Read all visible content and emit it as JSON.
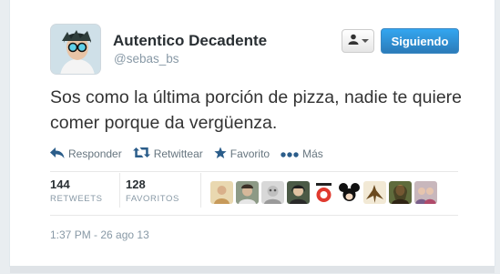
{
  "user": {
    "name": "Autentico Decadente",
    "screen_name": "@sebas_bs",
    "avatar_icon": "user-avatar"
  },
  "follow_button": {
    "label": "Siguiendo",
    "color": "#2b7bb9"
  },
  "user_dropdown_icon": "user-dropdown-icon",
  "tweet": {
    "text": "Sos como la última porción de pizza, nadie te quiere comer porque da vergüenza."
  },
  "actions": [
    {
      "label": "Responder",
      "icon": "reply-icon"
    },
    {
      "label": "Retwittear",
      "icon": "retweet-icon"
    },
    {
      "label": "Favorito",
      "icon": "star-icon"
    },
    {
      "label": "Más",
      "icon": "more-icon"
    }
  ],
  "stats": {
    "retweets": {
      "count": "144",
      "label": "RETWEETS"
    },
    "favorites": {
      "count": "128",
      "label": "FAVORITOS"
    }
  },
  "favoriter_avatars": [
    {
      "icon": "favoriter-avatar",
      "color": "#d9c08f"
    },
    {
      "icon": "favoriter-avatar",
      "color": "#7a8a6d"
    },
    {
      "icon": "favoriter-avatar",
      "color": "#c9c9c9"
    },
    {
      "icon": "favoriter-avatar",
      "color": "#3f4a3e"
    },
    {
      "icon": "favoriter-avatar",
      "color": "#e03a2f"
    },
    {
      "icon": "favoriter-avatar",
      "color": "#2a2a2a"
    },
    {
      "icon": "favoriter-avatar",
      "color": "#b38a3f"
    },
    {
      "icon": "favoriter-avatar",
      "color": "#6e5a3a"
    },
    {
      "icon": "favoriter-avatar",
      "color": "#a88a8f"
    }
  ],
  "timestamp": "1:37 PM - 26 ago 13"
}
